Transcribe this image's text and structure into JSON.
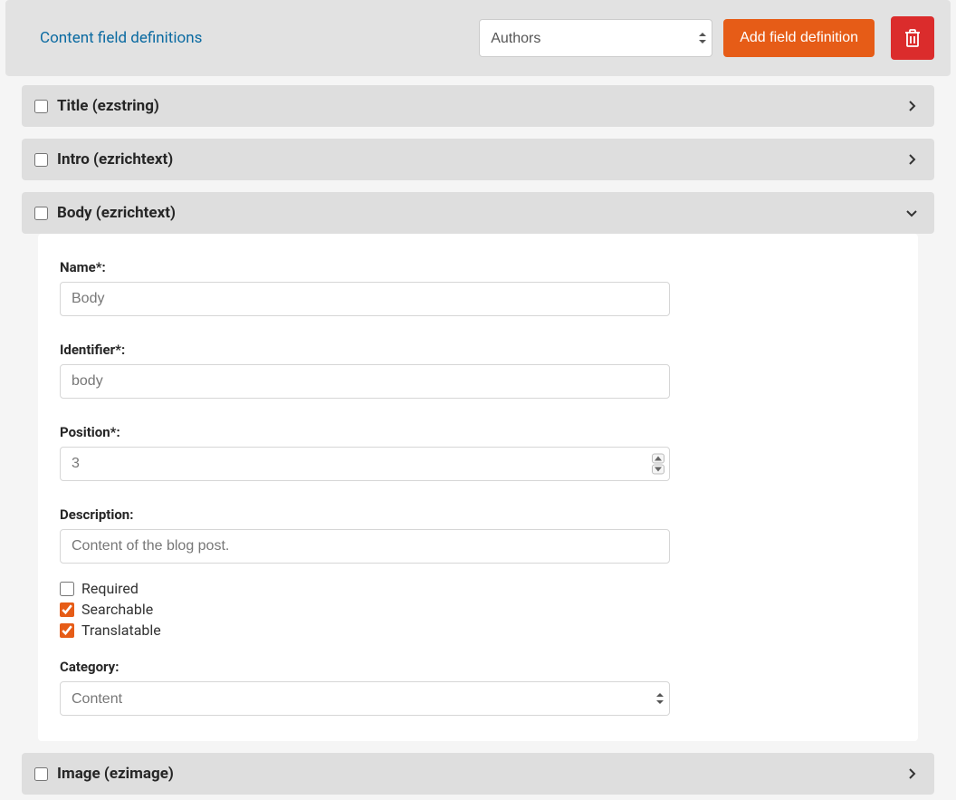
{
  "header": {
    "title": "Content field definitions",
    "select_value": "Authors",
    "add_button": "Add field definition"
  },
  "fields": [
    {
      "title": "Title (ezstring)",
      "checked": false,
      "expanded": false
    },
    {
      "title": "Intro (ezrichtext)",
      "checked": false,
      "expanded": false
    },
    {
      "title": "Body (ezrichtext)",
      "checked": false,
      "expanded": true
    },
    {
      "title": "Image (ezimage)",
      "checked": false,
      "expanded": false
    }
  ],
  "body_form": {
    "labels": {
      "name": "Name*:",
      "identifier": "Identifier*:",
      "position": "Position*:",
      "description": "Description:",
      "required": "Required",
      "searchable": "Searchable",
      "translatable": "Translatable",
      "category": "Category:"
    },
    "values": {
      "name": "Body",
      "identifier": "body",
      "position": "3",
      "description": "Content of the blog post.",
      "required": false,
      "searchable": true,
      "translatable": true,
      "category": "Content"
    }
  }
}
